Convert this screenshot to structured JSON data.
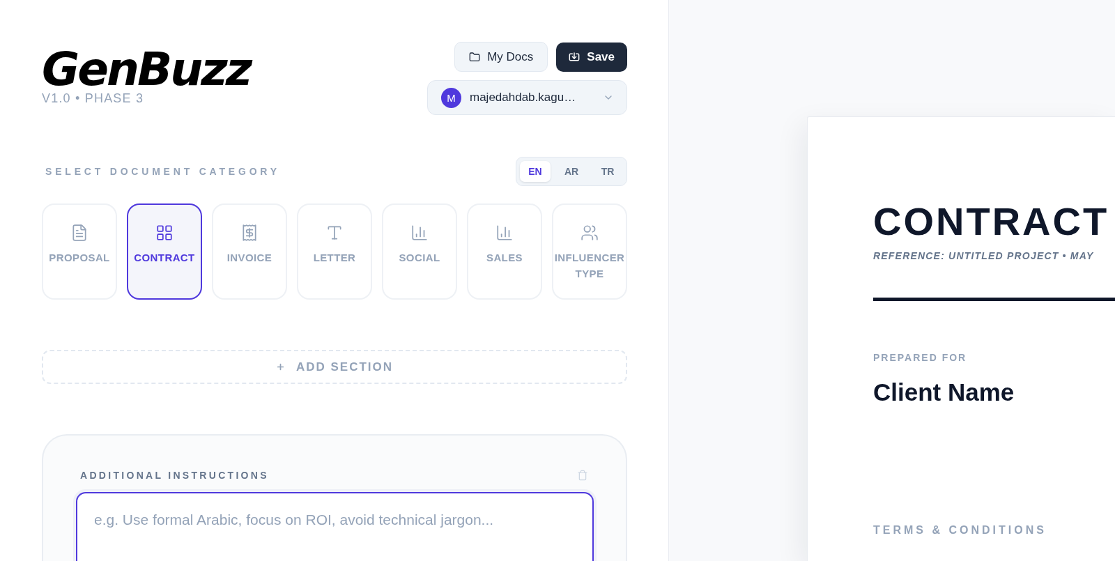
{
  "brand": {
    "logo": "GenBuzz",
    "version": "V1.0 • PHASE 3"
  },
  "actions": {
    "my_docs": "My Docs",
    "save": "Save"
  },
  "account": {
    "initial": "M",
    "user": "majedahdab.kagu…"
  },
  "category": {
    "heading": "SELECT DOCUMENT CATEGORY",
    "languages": [
      {
        "label": "EN",
        "selected": true
      },
      {
        "label": "AR",
        "selected": false
      },
      {
        "label": "TR",
        "selected": false
      }
    ],
    "tiles": [
      {
        "label": "PROPOSAL",
        "kind": "document",
        "selected": false
      },
      {
        "label": "CONTRACT",
        "kind": "grid",
        "selected": true
      },
      {
        "label": "INVOICE",
        "kind": "receipt",
        "selected": false
      },
      {
        "label": "LETTER",
        "kind": "text",
        "selected": false
      },
      {
        "label": "SOCIAL",
        "kind": "chart",
        "selected": false
      },
      {
        "label": "SALES",
        "kind": "chart",
        "selected": false
      },
      {
        "label": "INFLUENCER TYPE",
        "kind": "people",
        "selected": false
      }
    ]
  },
  "add_section": {
    "label": "ADD SECTION"
  },
  "instructions": {
    "heading": "ADDITIONAL INSTRUCTIONS",
    "placeholder": "e.g. Use formal Arabic, focus on ROI, avoid technical jargon...",
    "focused": true
  },
  "preview": {
    "title": "CONTRACT",
    "reference": "REFERENCE: UNTITLED PROJECT • MAY",
    "prepared_label": "PREPARED FOR",
    "client": "Client Name",
    "section": "TERMS & CONDITIONS"
  }
}
